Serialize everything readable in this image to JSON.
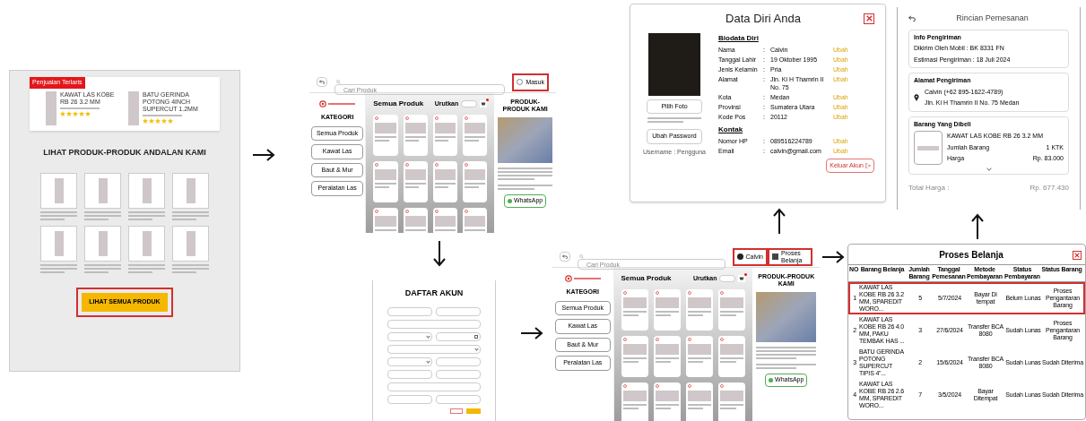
{
  "home_screen": {
    "badge": "Penjualan Terlaris",
    "featured": [
      {
        "name": "KAWAT LAS KOBE RB 26 3.2 MM",
        "stars": 5
      },
      {
        "name": "BATU GERINDA POTONG 4INCH SUPERCUT 1.2MM",
        "stars": 5
      }
    ],
    "heading": "LIHAT PRODUK-PRODUK ANDALAN KAMI",
    "button": {
      "label": "LIHAT SEMUA PRODUK",
      "highlighted": true
    }
  },
  "catalog_screen": {
    "search_placeholder": "Cari Produk",
    "account_buttons": [
      {
        "label": "Masuk",
        "kind": "login",
        "highlighted": true
      }
    ],
    "category_title": "KATEGORI",
    "categories": [
      "Semua Produk",
      "Kawat Las",
      "Baut & Mur",
      "Peralatan Las"
    ],
    "section_title": "Semua Produk",
    "sort_label": "Urutkan",
    "side_title": "PRODUK-PRODUK KAMI",
    "whatsapp_label": "WhatsApp"
  },
  "register_screen": {
    "title": "DAFTAR AKUN",
    "form_rows": [
      [
        {
          "kind": "text"
        },
        {
          "kind": "text"
        }
      ],
      [
        {
          "kind": "text"
        }
      ],
      [
        {
          "kind": "select"
        },
        {
          "kind": "date"
        }
      ],
      [
        {
          "kind": "select"
        }
      ],
      [
        {
          "kind": "select"
        },
        {
          "kind": "text"
        }
      ],
      [
        {
          "kind": "text"
        },
        {
          "kind": "text"
        }
      ],
      [
        {
          "kind": "text"
        }
      ],
      [
        {
          "kind": "text"
        },
        {
          "kind": "text"
        }
      ]
    ]
  },
  "catalog_logged_in_screen": {
    "search_placeholder": "Cari Produk",
    "account_buttons": [
      {
        "label": "Calvin",
        "kind": "avatar",
        "highlighted": true
      },
      {
        "label": "Proses Belanja",
        "kind": "orders",
        "highlighted": true
      }
    ],
    "category_title": "KATEGORI",
    "categories": [
      "Semua Produk",
      "Kawat Las",
      "Baut & Mur",
      "Peralatan Las"
    ],
    "section_title": "Semua Produk",
    "sort_label": "Urutkan",
    "side_title": "PRODUK-PRODUK KAMI",
    "whatsapp_label": "WhatsApp"
  },
  "profile_modal": {
    "title": "Data Diri Anda",
    "photo_button": "Pilih Foto",
    "password_button": "Ubah Password",
    "username": "Username : Pengguna",
    "sections": [
      {
        "title": "Biodata Diri",
        "fields": [
          {
            "label": "Nama",
            "separator": ":",
            "value": "Calvin",
            "action": "Ubah"
          },
          {
            "label": "Tanggal Lahir",
            "separator": ":",
            "value": "19 Oktober 1995",
            "action": "Ubah"
          },
          {
            "label": "Jenis Kelamin",
            "separator": ":",
            "value": "Pria",
            "action": "Ubah"
          },
          {
            "label": "Alamat",
            "separator": ":",
            "value": "Jln. Ki H Thamrin II No. 75",
            "action": "Ubah"
          },
          {
            "label": "Kota",
            "separator": ":",
            "value": "Medan",
            "action": "Ubah"
          },
          {
            "label": "Provinsi",
            "separator": ":",
            "value": "Sumatera Utara",
            "action": "Ubah"
          },
          {
            "label": "Kode Pos",
            "separator": ":",
            "value": "20112",
            "action": "Ubah"
          }
        ]
      },
      {
        "title": "Kontak",
        "fields": [
          {
            "label": "Nomor HP",
            "separator": ":",
            "value": "089516224789",
            "action": "Ubah"
          },
          {
            "label": "Email",
            "separator": ":",
            "value": "calvin@gmail.com",
            "action": "Ubah"
          }
        ]
      }
    ],
    "logout_button": "Keluar Akun"
  },
  "order_detail_screen": {
    "title": "Rincian Pemesanan",
    "shipping": {
      "title": "Info Pengiriman",
      "lines": [
        "Dikirim Oleh Mobil : BK 8331 FN",
        "Estimasi Pengiriman : 18 Juli 2024"
      ]
    },
    "address": {
      "title": "Alamat Pengiriman",
      "lines": [
        "Calvin (+62 895-1622-4789)",
        "Jln. Ki H Thamrin II No. 75 Medan"
      ]
    },
    "items": {
      "title": "Barang Yang Dibeli",
      "name": "KAWAT LAS KOBE RB 26 3.2 MM",
      "rows": [
        {
          "label": "Jumlah Barang",
          "value": "1 KTK"
        },
        {
          "label": "Harga",
          "value": "Rp. 83.000"
        }
      ]
    },
    "total_label": "Total Harga :",
    "total_value": "Rp. 677.430"
  },
  "order_list_modal": {
    "title": "Proses Belanja",
    "columns": [
      "NO",
      "Barang Belanja",
      "Jumlah Barang",
      "Tanggal Pemesanan",
      "Metode Pembayaran",
      "Status Pembayaran",
      "Status Barang"
    ],
    "rows": [
      {
        "cells": [
          "1",
          "KAWAT LAS KOBE RB 26 3.2 MM, SPAREDIT WORO...",
          "5",
          "5/7/2024",
          "Bayar Di tempat",
          "Belum Lunas",
          "Proses Pengantaran Barang"
        ],
        "highlighted": true
      },
      {
        "cells": [
          "2",
          "KAWAT LAS KOBE RB 26 4.0 MM, PAKU TEMBAK HAS ...",
          "3",
          "27/6/2024",
          "Transfer BCA 8080",
          "Sudah Lunas",
          "Proses Pengantaran Barang"
        ],
        "highlighted": false
      },
      {
        "cells": [
          "3",
          "BATU GERINDA POTONG SUPERCUT TIPIS 4\"...",
          "2",
          "15/6/2024",
          "Transfer BCA 8080",
          "Sudah Lunas",
          "Sudah Diterima"
        ],
        "highlighted": false
      },
      {
        "cells": [
          "4",
          "KAWAT LAS KOBE RB 26 2.6 MM, SPAREDIT WORO...",
          "7",
          "3/5/2024",
          "Bayar Ditempat",
          "Sudah Lunas",
          "Sudah Diterima"
        ],
        "highlighted": false
      }
    ]
  }
}
